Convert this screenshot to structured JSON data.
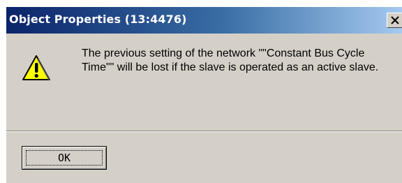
{
  "window": {
    "title": "Object Properties (13:4476)",
    "close_glyph": "X"
  },
  "message": {
    "icon": "warning-icon",
    "text": "The previous setting of the network \"\"Constant Bus Cycle Time\"\" will be lost if the slave is operated as an active slave."
  },
  "buttons": {
    "ok_label": "OK"
  },
  "colors": {
    "dialog_bg": "#d4d0c8",
    "title_start": "#0a246a",
    "title_end": "#a6caf0",
    "warning_yellow": "#ffff00"
  }
}
